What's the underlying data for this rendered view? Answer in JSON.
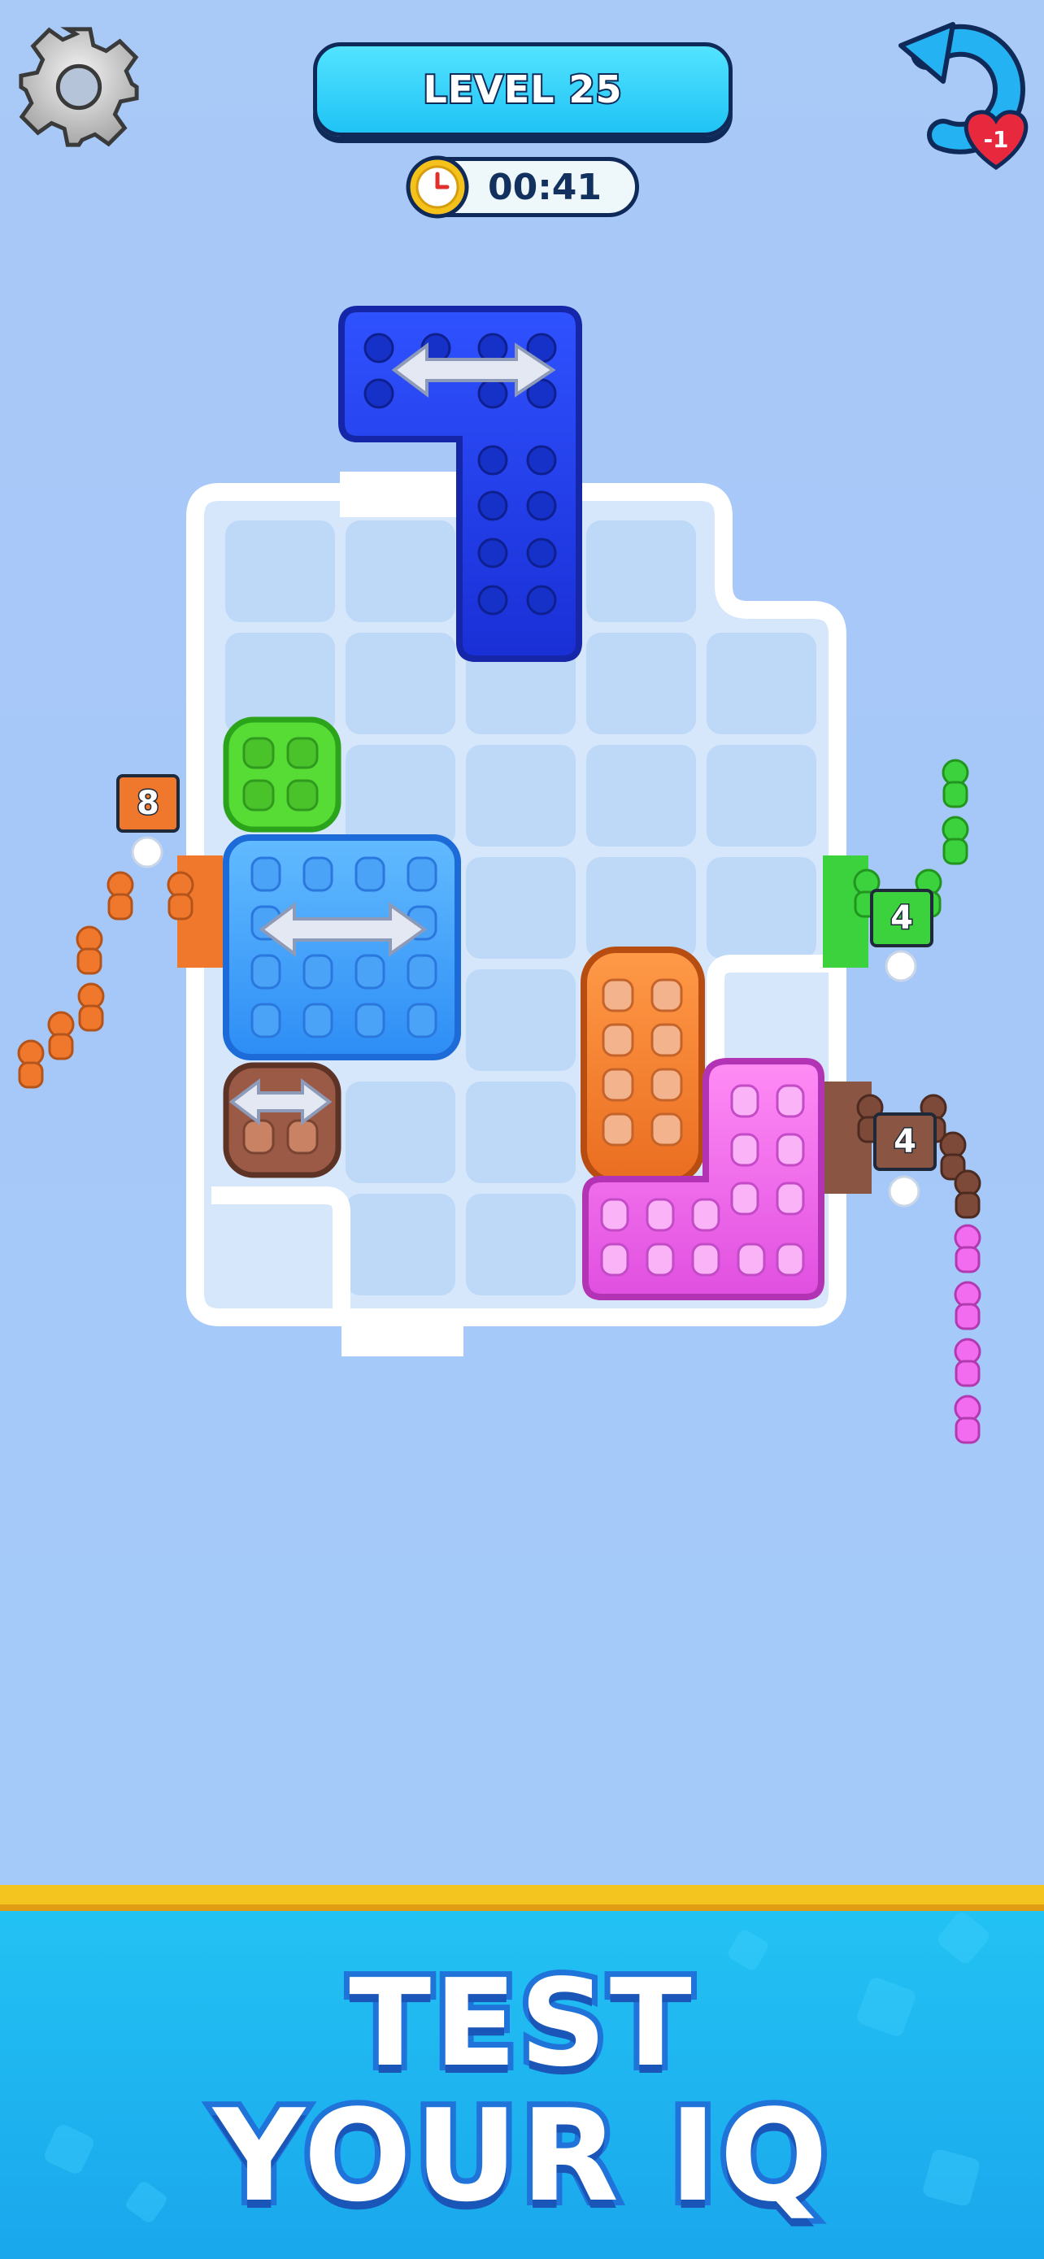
{
  "header": {
    "level_label": "LEVEL 25",
    "timer": "00:41",
    "undo_badge": "-1"
  },
  "icons": {
    "settings": "gear-icon",
    "timer": "clock-icon",
    "undo": "undo-arrow-icon",
    "lives": "heart-icon",
    "move_hint": "double-arrow-icon"
  },
  "crowds": {
    "orange_count": "8",
    "green_count": "4",
    "brown_count": "4"
  },
  "colors": {
    "orange": "#f0782c",
    "green": "#3cd23e",
    "brown": "#8a5542",
    "blue_dark": "#1e3be8",
    "blue_light": "#3ea8ff",
    "pink": "#f26cf0"
  },
  "banner": {
    "line1": "TEST",
    "line2": "YOUR IQ"
  }
}
